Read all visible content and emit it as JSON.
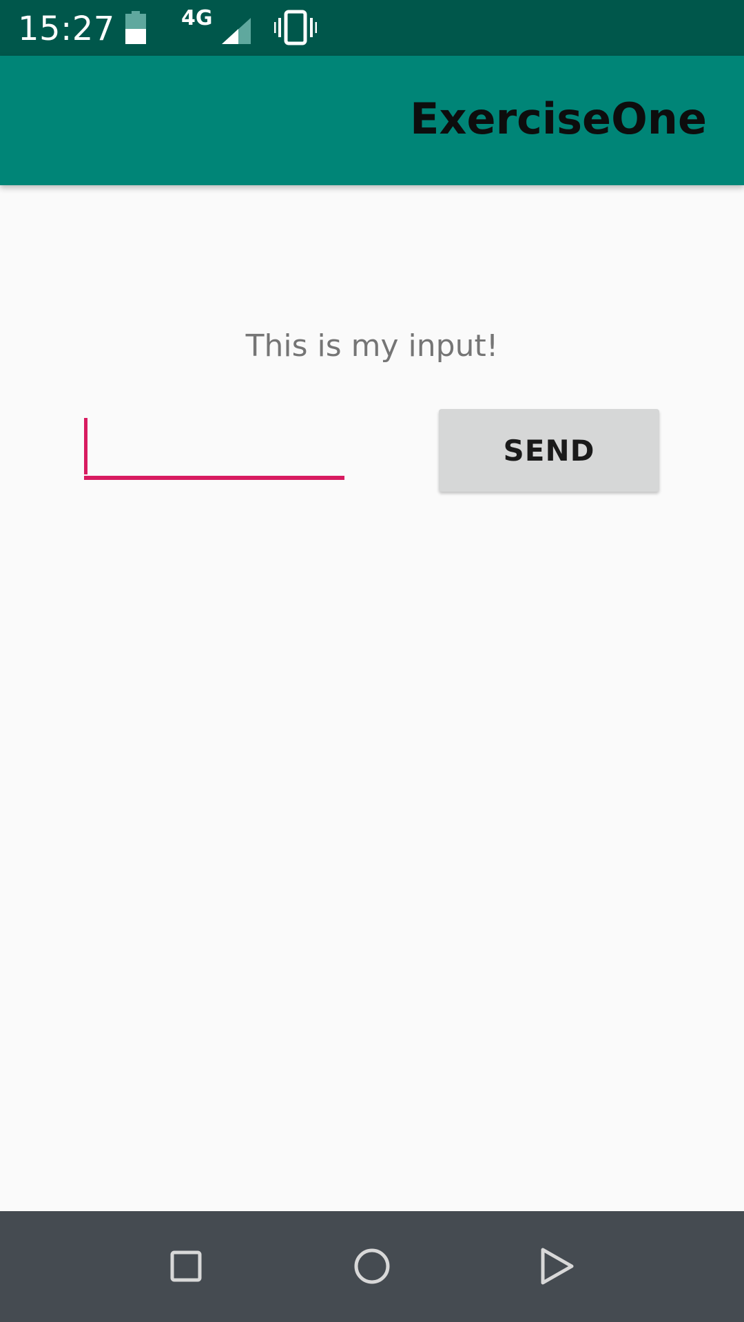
{
  "status_bar": {
    "time": "15:27",
    "network": "4G",
    "icons": [
      "battery-icon",
      "signal-icon",
      "vibrate-icon"
    ]
  },
  "app_bar": {
    "title": "ExerciseOne"
  },
  "main": {
    "label": "This is my input!",
    "input": {
      "value": "",
      "placeholder": ""
    },
    "send_button": "SEND"
  },
  "nav_bar": {
    "icons": [
      "recents-icon",
      "home-icon",
      "back-icon"
    ]
  },
  "colors": {
    "status_bar": "#00574b",
    "app_bar": "#008577",
    "accent": "#d81b60",
    "background": "#fafafa",
    "button": "#d6d7d7",
    "nav_bar": "#454b51"
  }
}
